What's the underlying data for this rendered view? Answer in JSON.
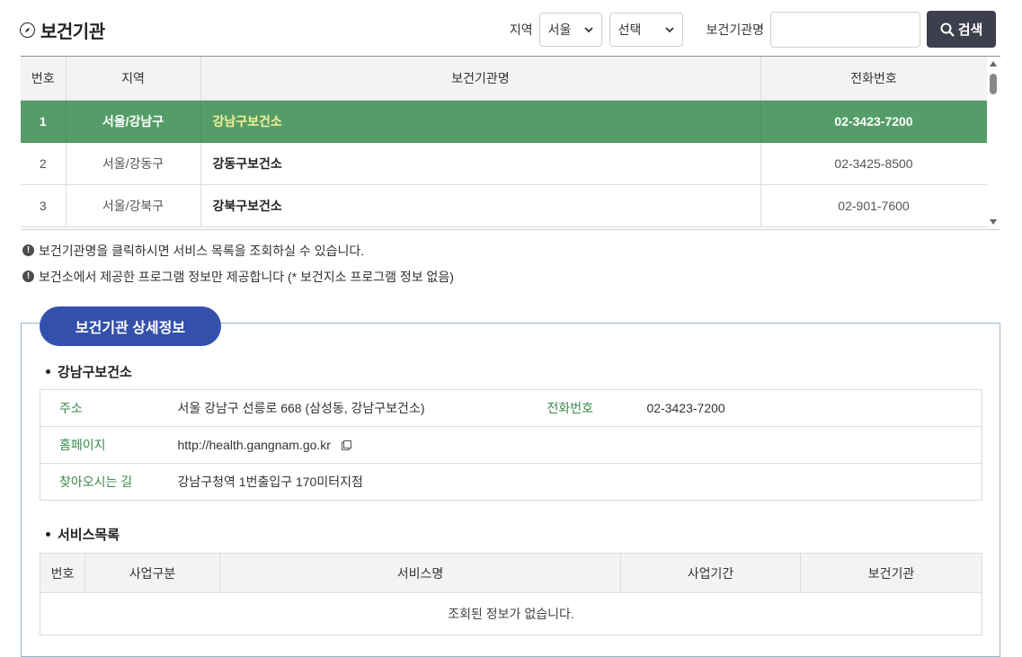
{
  "page": {
    "title": "보건기관"
  },
  "search": {
    "region_label": "지역",
    "region_value": "서울",
    "district_value": "선택",
    "org_label": "보건기관명",
    "org_value": "",
    "button_label": "검색"
  },
  "list": {
    "headers": [
      "번호",
      "지역",
      "보건기관명",
      "전화번호"
    ],
    "rows": [
      {
        "no": "1",
        "region": "서울/강남구",
        "name": "강남구보건소",
        "phone": "02-3423-7200"
      },
      {
        "no": "2",
        "region": "서울/강동구",
        "name": "강동구보건소",
        "phone": "02-3425-8500"
      },
      {
        "no": "3",
        "region": "서울/강북구",
        "name": "강북구보건소",
        "phone": "02-901-7600"
      }
    ]
  },
  "notes": [
    "보건기관명을 클릭하시면 서비스 목록을 조회하실 수 있습니다.",
    "보건소에서 제공한 프로그램 정보만 제공합니다 (* 보건지소 프로그램 정보 없음)"
  ],
  "detail": {
    "tab_label": "보건기관 상세정보",
    "org_name": "강남구보건소",
    "address_label": "주소",
    "address": "서울 강남구 선릉로 668 (삼성동, 강남구보건소)",
    "phone_label": "전화번호",
    "phone": "02-3423-7200",
    "homepage_label": "홈페이지",
    "homepage": "http://health.gangnam.go.kr",
    "directions_label": "찾아오시는 길",
    "directions": "강남구청역 1번출입구 170미터지점"
  },
  "services": {
    "title": "서비스목록",
    "headers": [
      "번호",
      "사업구분",
      "서비스명",
      "사업기간",
      "보건기관"
    ],
    "empty_message": "조회된 정보가 없습니다."
  }
}
